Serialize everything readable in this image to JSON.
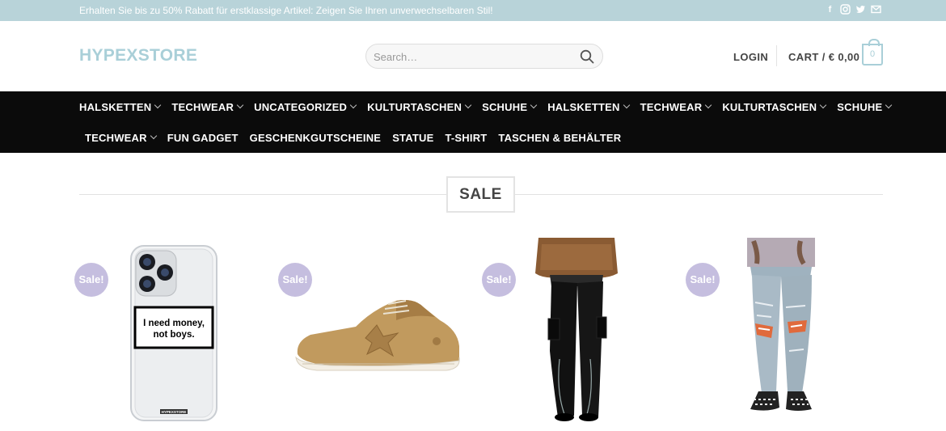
{
  "topbar": {
    "promo": "Erhalten Sie bis zu 50% Rabatt für erstklassige Artikel: Zeigen Sie Ihren unverwechselbaren Stil!",
    "social": [
      "facebook-icon",
      "instagram-icon",
      "twitter-icon",
      "email-icon"
    ]
  },
  "header": {
    "logo": "HYPEXSTORE",
    "search_placeholder": "Search…",
    "login": "LOGIN",
    "cart": "CART / € 0,00",
    "cart_count": "0"
  },
  "nav": {
    "row1": [
      "HALSKETTEN",
      "TECHWEAR",
      "UNCATEGORIZED",
      "KULTURTASCHEN",
      "SCHUHE",
      "HALSKETTEN",
      "TECHWEAR",
      "KULTURTASCHEN",
      "SCHUHE"
    ],
    "row2": [
      "TECHWEAR",
      "FUN GADGET",
      "GESCHENKGUTSCHEINE",
      "STATUE",
      "T-SHIRT",
      "TASCHEN & BEHÄLTER"
    ]
  },
  "section": {
    "title": "SALE"
  },
  "products": [
    {
      "badge": "Sale!",
      "image": "phone-case-image",
      "case_text_line1": "I need money,",
      "case_text_line2": "not boys.",
      "case_brand": "HYPEXSTORE"
    },
    {
      "badge": "Sale!",
      "image": "sneaker-image"
    },
    {
      "badge": "Sale!",
      "image": "black-cargo-pants-image"
    },
    {
      "badge": "Sale!",
      "image": "ripped-jeans-image"
    }
  ],
  "colors": {
    "accent": "#a9cfd8",
    "topbar": "#b8d3d9",
    "nav": "#0b0b0b",
    "badge": "#c5bedf"
  }
}
